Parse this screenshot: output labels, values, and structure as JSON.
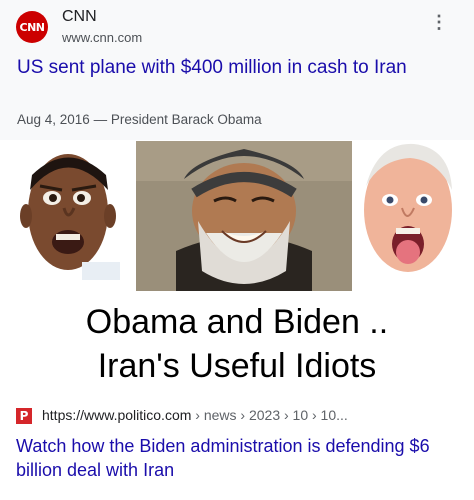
{
  "result1": {
    "source_logo_text": "CNN",
    "source_name": "CNN",
    "source_url": "www.cnn.com",
    "menu_icon": "kebab-icon",
    "headline": "US sent plane with $400 million in cash to Iran",
    "meta": "Aug 4, 2016 — President Barack Obama"
  },
  "meme": {
    "caption_line1": "Obama and Biden ..",
    "caption_line2": "Iran's Useful Idiots"
  },
  "result2": {
    "favicon_letter": "P",
    "url": "https://www.politico.com",
    "breadcrumbs": " › news › 2023 › 10 › 10...",
    "headline": "Watch how the Biden administration is defending $6 billion deal with Iran"
  },
  "colors": {
    "link": "#1a0dab",
    "cnn_red": "#cc0000",
    "politico_red": "#d5262a"
  }
}
